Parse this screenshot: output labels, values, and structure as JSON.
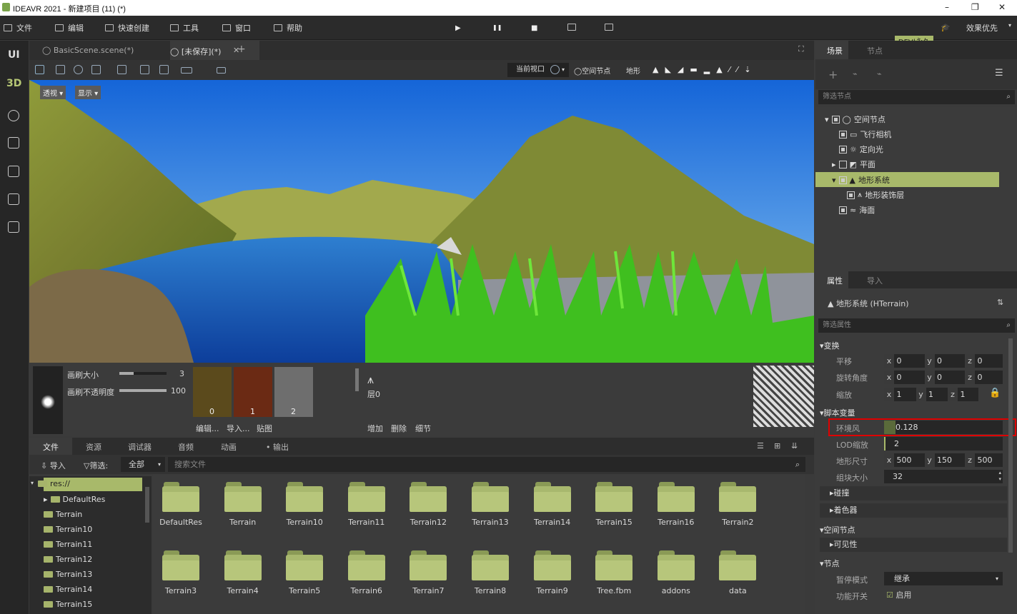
{
  "window": {
    "title": "IDEAVR 2021 - 新建项目 (11) (*)",
    "min": "–",
    "max": "❐",
    "close": "✕"
  },
  "menu": {
    "file": "文件",
    "edit": "编辑",
    "quick": "快速创建",
    "tools": "工具",
    "window": "窗口",
    "help": "帮助",
    "play": "▶",
    "pause": "❚❚",
    "stop": "■",
    "dev": "DEV|永久",
    "quality": "效果优先"
  },
  "sidebar": {
    "ui": "UI",
    "d3": "3D"
  },
  "tabs": [
    "BasicScene.scene(*)",
    "[未保存](*)",
    "✕",
    "+"
  ],
  "viewport_toolbar": {
    "view_select": "当前视口",
    "spatial": "空间节点",
    "terrain": "地形"
  },
  "viewport": {
    "persp": "透视 ▾",
    "display": "显示 ▾"
  },
  "brush": {
    "size_label": "画刷大小",
    "size_value": "3",
    "opacity_label": "画刷不透明度",
    "opacity_value": "100",
    "size_frac": 0.3,
    "opacity_frac": 1.0,
    "tex": [
      "0",
      "1",
      "2"
    ],
    "edit": "编辑...",
    "import": "导入...",
    "texture": "贴图",
    "layer": "层0",
    "add": "增加",
    "delete": "删除",
    "detail": "细节"
  },
  "bottom_tabs": [
    "文件",
    "资源",
    "调试器",
    "音频",
    "动画",
    "• 输出"
  ],
  "filebar": {
    "import": "导入",
    "filter": "筛选:",
    "all": "全部",
    "search_ph": "搜索文件"
  },
  "file_tree": [
    "res://",
    "DefaultRes",
    "Terrain",
    "Terrain10",
    "Terrain11",
    "Terrain12",
    "Terrain13",
    "Terrain14",
    "Terrain15"
  ],
  "folders_row1": [
    "DefaultRes",
    "Terrain",
    "Terrain10",
    "Terrain11",
    "Terrain12",
    "Terrain13",
    "Terrain14",
    "Terrain15",
    "Terrain16",
    "Terrain2"
  ],
  "folders_row2": [
    "Terrain3",
    "Terrain4",
    "Terrain5",
    "Terrain6",
    "Terrain7",
    "Terrain8",
    "Terrain9",
    "Tree.fbm",
    "addons",
    "data"
  ],
  "scene": {
    "tab1": "场景",
    "tab2": "节点",
    "filter": "筛选节点",
    "nodes": [
      "空间节点",
      "飞行相机",
      "定向光",
      "平面",
      "地形系统",
      "地形装饰层",
      "海面"
    ]
  },
  "props": {
    "tab1": "属性",
    "tab2": "导入",
    "title": "地形系统 (HTerrain)",
    "filter": "筛选属性",
    "transform": "▾变换",
    "translate": "平移",
    "rotate": "旋转角度",
    "scale": "缩放",
    "t": [
      "0",
      "0",
      "0"
    ],
    "r": [
      "0",
      "0",
      "0"
    ],
    "s": [
      "1",
      "1",
      "1"
    ],
    "script_vars": "▾脚本变量",
    "wind": "环境风",
    "wind_value": "0.128",
    "lod": "LOD缩放",
    "lod_value": "2",
    "tsize": "地形尺寸",
    "ts": [
      "500",
      "150",
      "500"
    ],
    "chunk": "组块大小",
    "chunk_value": "32",
    "collision": "▸碰撞",
    "shader": "▸着色器",
    "spatial": "▾空间节点",
    "visible": "▸可见性",
    "node": "▾节点",
    "pause_mode": "暂停模式",
    "pause_value": "继承",
    "enable": "功能开关",
    "enable_value": "启用"
  }
}
